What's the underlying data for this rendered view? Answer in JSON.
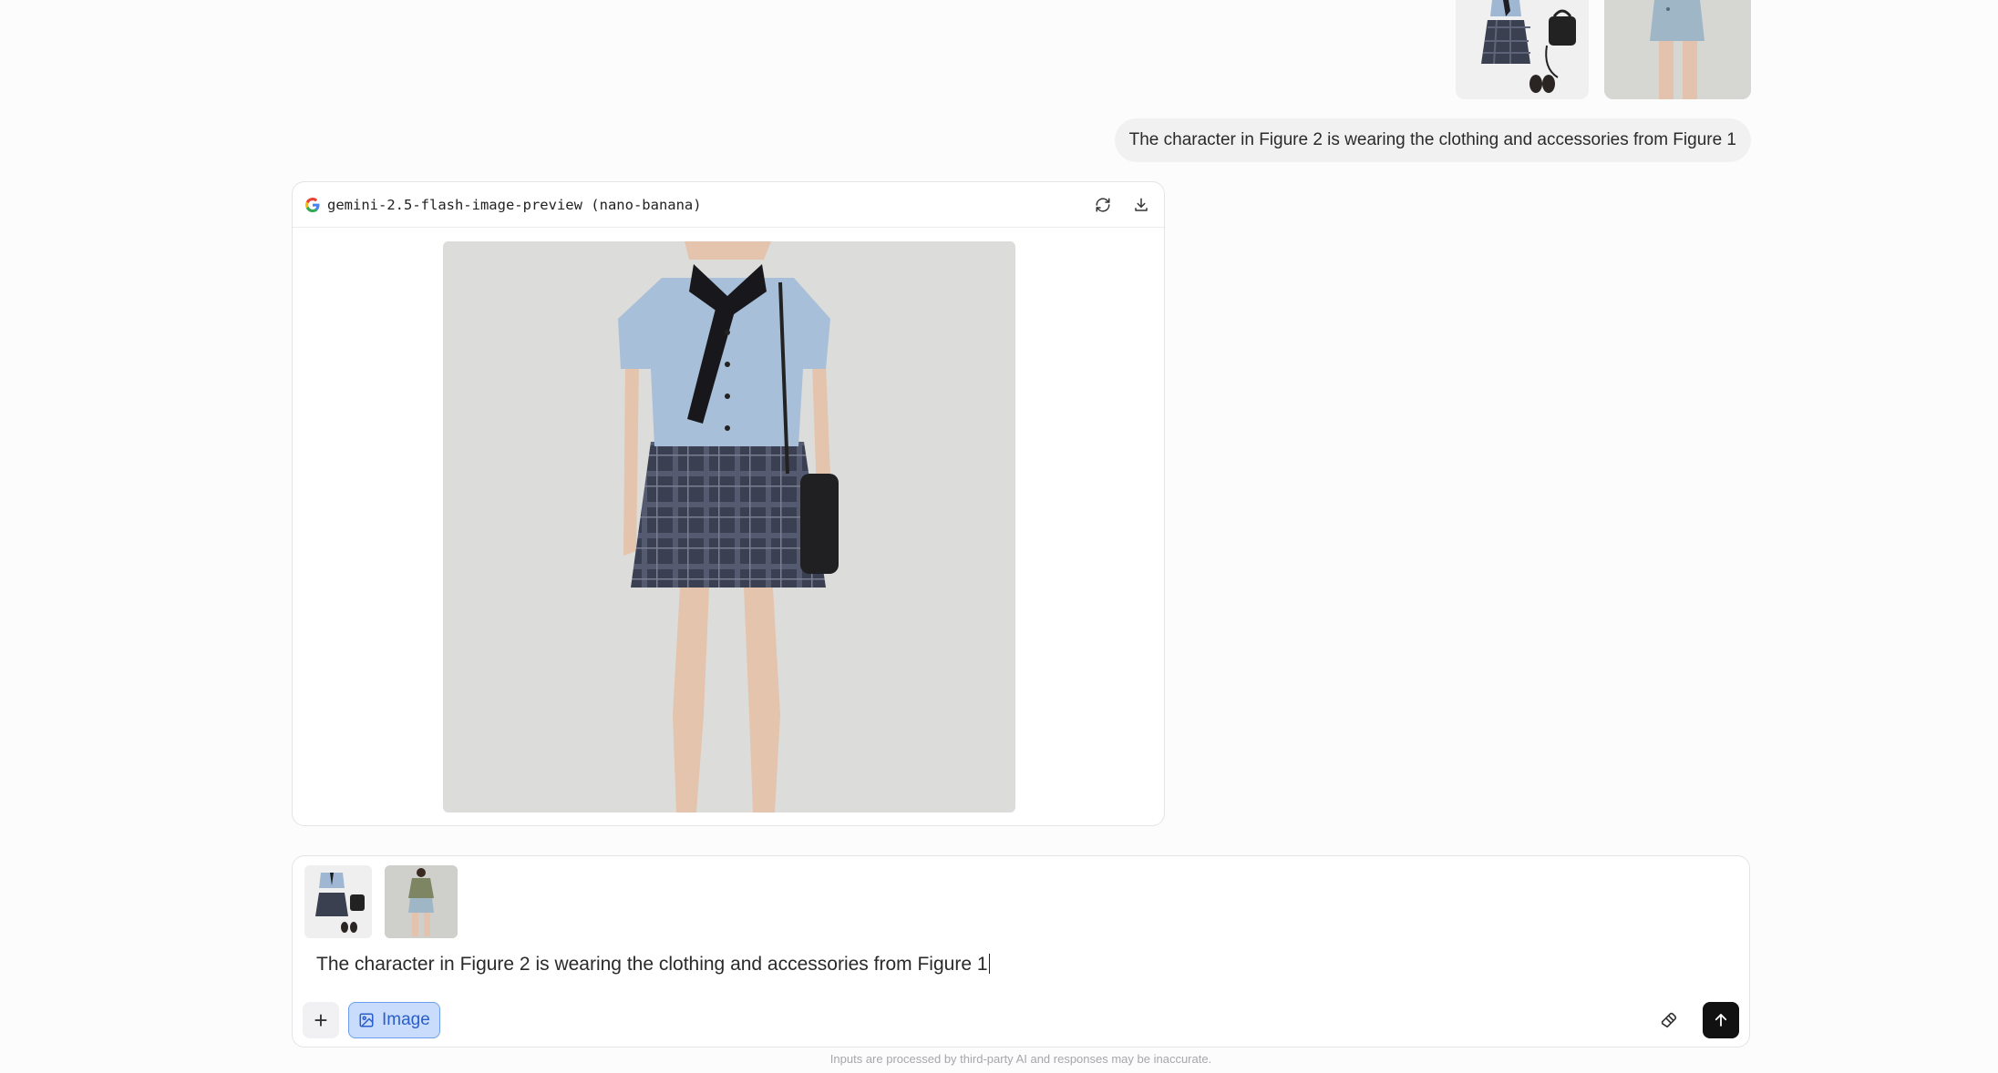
{
  "conversation": {
    "user_message": {
      "text": "The character in Figure 2 is wearing the clothing and accessories from Figure 1",
      "attachments": [
        "outfit-flatlay-image",
        "model-photo-image"
      ]
    },
    "response": {
      "model_label": "gemini-2.5-flash-image-preview (nano-banana)",
      "provider_icon": "google-icon",
      "actions": [
        "refresh-icon",
        "download-icon"
      ],
      "image": "generated-outfit-image"
    }
  },
  "composer": {
    "attachments": [
      "outfit-flatlay-image",
      "model-photo-image"
    ],
    "text": "The character in Figure 2 is wearing the clothing and accessories from Figure 1",
    "plus_label": "+",
    "image_label": "Image",
    "accent": "#2a5ec9"
  },
  "footer": {
    "disclaimer": "Inputs are processed by third-party AI and responses may be inaccurate."
  }
}
